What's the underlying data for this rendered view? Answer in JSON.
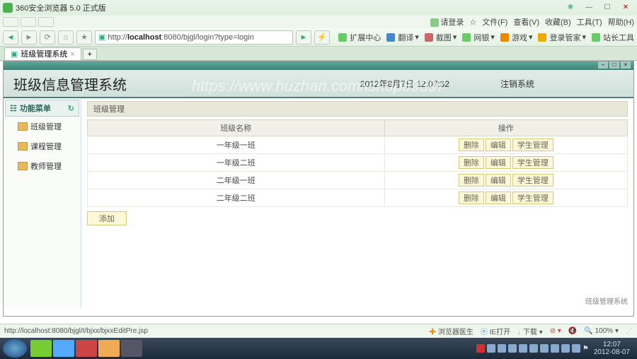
{
  "browser": {
    "title": "360安全浏览器 5.0 正式版",
    "url_prefix": "http://",
    "url_host": "localhost",
    "url_path": ":8080/bjgl/login?type=login",
    "tab_title": "班级管理系统",
    "menus": {
      "login": "请登录",
      "file": "文件(F)",
      "view": "查看(V)",
      "fav": "收藏(B)",
      "tools": "工具(T)",
      "help": "帮助(H)"
    },
    "toolbar": {
      "ext": "扩展中心",
      "translate": "翻译",
      "screenshot": "截图",
      "netbank": "网银",
      "game": "游戏",
      "loginmgr": "登录管家",
      "sitetool": "站长工具"
    },
    "status_url": "http://localhost:8080/bjgl/t/bjxx/bjxxEditPre.jsp",
    "status": {
      "doctor": "浏览器医生",
      "ie": "IE打开",
      "download": "下载",
      "mute": "",
      "zoom": "100%"
    }
  },
  "app": {
    "title": "班级信息管理系统",
    "watermark": "https://www.huzhan.com/ishop39397",
    "date": "2012年8月7日  12:07:32",
    "logout": "注销系统",
    "side_header": "功能菜单",
    "side_items": [
      "班级管理",
      "课程管理",
      "教师管理"
    ],
    "crumb": "班级管理",
    "columns": {
      "name": "班级名称",
      "ops": "操作"
    },
    "rows": [
      {
        "name": "一年级一班"
      },
      {
        "name": "一年级二班"
      },
      {
        "name": "二年级一班"
      },
      {
        "name": "二年级二班"
      }
    ],
    "ops": {
      "del": "删除",
      "edit": "编辑",
      "stu": "学生管理"
    },
    "add": "添加",
    "bottom_crumb": "班级管理系统"
  },
  "taskbar": {
    "time": "12:07",
    "date": "2012-08-07"
  }
}
